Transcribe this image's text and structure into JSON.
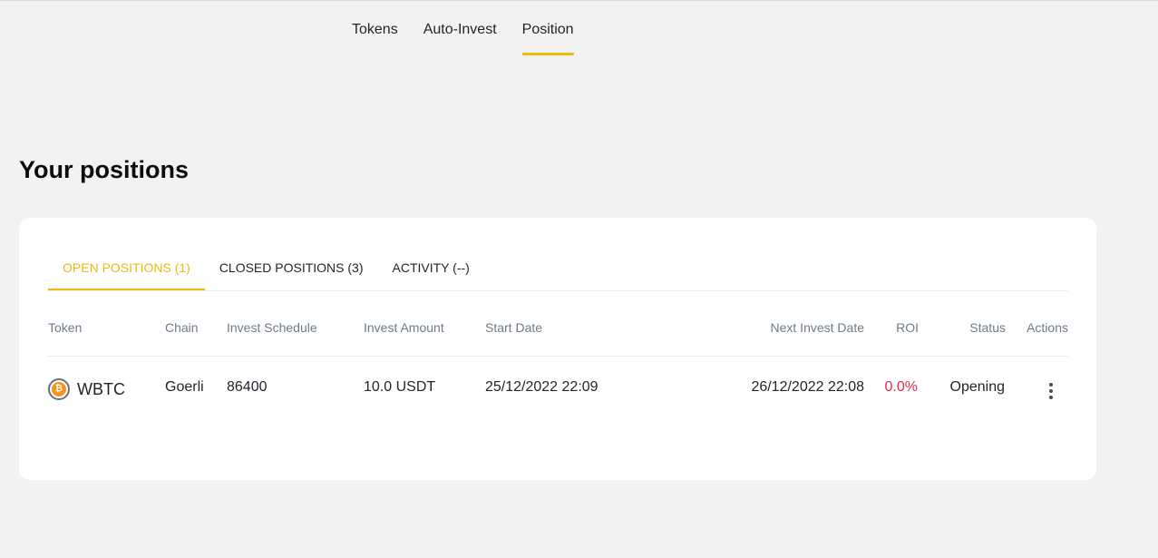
{
  "nav": {
    "items": [
      {
        "label": "Tokens"
      },
      {
        "label": "Auto-Invest"
      },
      {
        "label": "Position"
      }
    ],
    "active": "Position"
  },
  "page": {
    "title": "Your positions"
  },
  "tabs": [
    {
      "label": "OPEN POSITIONS (1)"
    },
    {
      "label": "CLOSED POSITIONS (3)"
    },
    {
      "label": "ACTIVITY (--)"
    }
  ],
  "table": {
    "headers": {
      "token": "Token",
      "chain": "Chain",
      "schedule": "Invest Schedule",
      "amount": "Invest Amount",
      "start": "Start Date",
      "next": "Next Invest Date",
      "roi": "ROI",
      "status": "Status",
      "actions": "Actions"
    },
    "rows": [
      {
        "token": "WBTC",
        "token_icon": "btc-coin-icon",
        "chain": "Goerli",
        "schedule": "86400",
        "amount": "10.0 USDT",
        "start": "25/12/2022 22:09",
        "next": "26/12/2022 22:08",
        "roi": "0.0%",
        "status": "Opening"
      }
    ]
  },
  "colors": {
    "accent": "#f0b90b",
    "negative": "#e0294a",
    "background": "#f2f2f2"
  }
}
